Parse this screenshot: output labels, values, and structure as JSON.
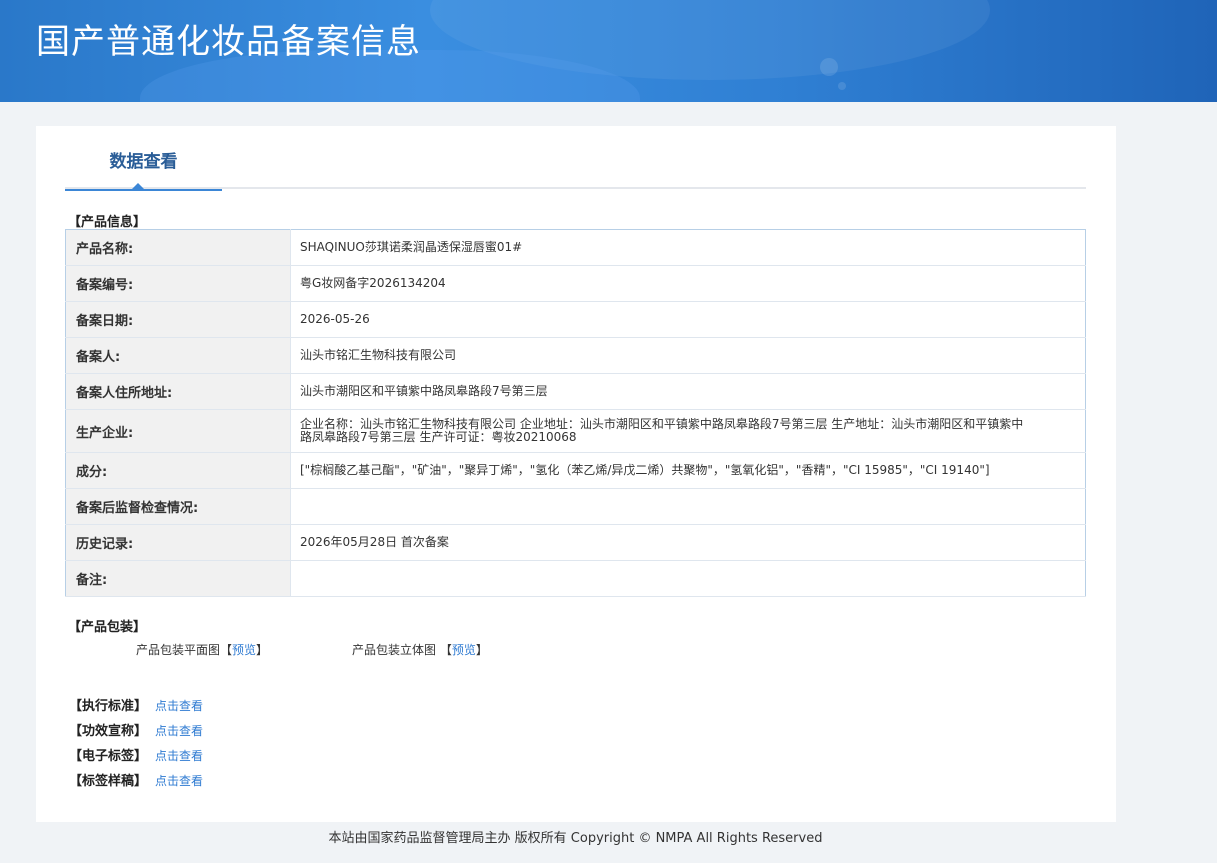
{
  "header": {
    "title": "国产普通化妆品备案信息"
  },
  "tabs": [
    {
      "label": "数据查看"
    }
  ],
  "product_info": {
    "section_label": "【产品信息】",
    "rows": [
      {
        "label": "产品名称:",
        "value": "SHAQINUO莎琪诺柔润晶透保湿唇蜜01#"
      },
      {
        "label": "备案编号:",
        "value": "粤G妆网备字2026134204"
      },
      {
        "label": "备案日期:",
        "value": "2026-05-26"
      },
      {
        "label": "备案人:",
        "value": "汕头市铭汇生物科技有限公司"
      },
      {
        "label": "备案人住所地址:",
        "value": "汕头市潮阳区和平镇紫中路凤皋路段7号第三层"
      },
      {
        "label": "生产企业:",
        "value": "企业名称：汕头市铭汇生物科技有限公司 企业地址：汕头市潮阳区和平镇紫中路凤皋路段7号第三层 生产地址：汕头市潮阳区和平镇紫中路凤皋路段7号第三层 生产许可证：粤妆20210068"
      },
      {
        "label": "成分:",
        "value": "[\"棕榈酸乙基己酯\"，\"矿油\"，\"聚异丁烯\"，\"氢化（苯乙烯/异戊二烯）共聚物\"，\"氢氧化铝\"，\"香精\"，\"CI 15985\"，\"CI 19140\"]"
      },
      {
        "label": "备案后监督检查情况:",
        "value": ""
      },
      {
        "label": "历史记录:",
        "value": "2026年05月28日 首次备案"
      },
      {
        "label": "备注:",
        "value": ""
      }
    ]
  },
  "packaging": {
    "section_label": "【产品包装】",
    "flat_label": "产品包装平面图",
    "flat_preview": "预览",
    "solid_label": "产品包装立体图",
    "solid_preview": "预览"
  },
  "standards": [
    {
      "label": "【执行标准】",
      "link": "点击查看"
    },
    {
      "label": "【功效宣称】",
      "link": "点击查看"
    },
    {
      "label": "【电子标签】",
      "link": "点击查看"
    },
    {
      "label": "【标签样稿】",
      "link": "点击查看"
    }
  ],
  "footer": {
    "text": "本站由国家药品监督管理局主办 版权所有 Copyright © NMPA All Rights Reserved"
  }
}
